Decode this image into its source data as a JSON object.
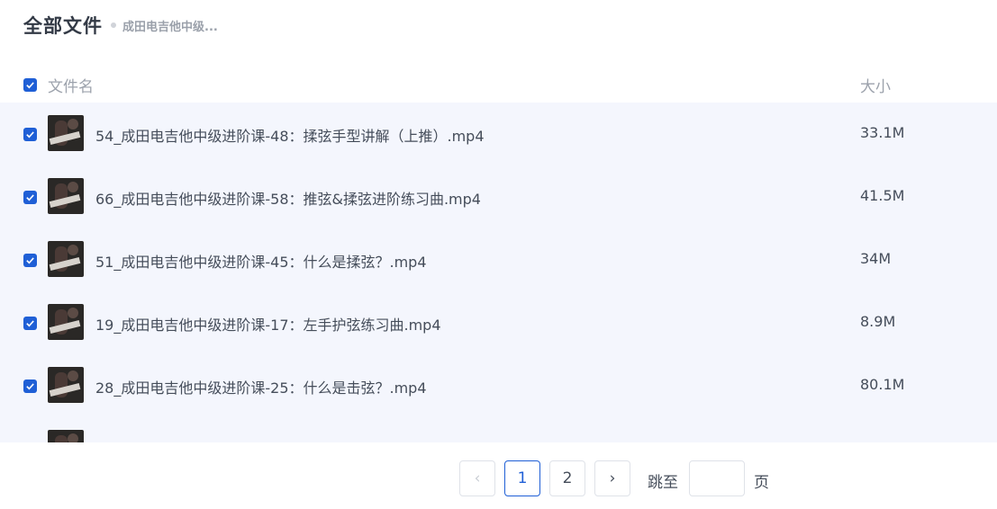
{
  "header": {
    "title": "全部文件",
    "breadcrumb": "成田电吉他中级..."
  },
  "columns": {
    "name": "文件名",
    "size": "大小"
  },
  "files": [
    {
      "name": "54_成田电吉他中级进阶课-48：揉弦手型讲解（上推）.mp4",
      "size": "33.1M",
      "checked": true
    },
    {
      "name": "66_成田电吉他中级进阶课-58：推弦&揉弦进阶练习曲.mp4",
      "size": "41.5M",
      "checked": true
    },
    {
      "name": "51_成田电吉他中级进阶课-45：什么是揉弦？.mp4",
      "size": "34M",
      "checked": true
    },
    {
      "name": "19_成田电吉他中级进阶课-17：左手护弦练习曲.mp4",
      "size": "8.9M",
      "checked": true
    },
    {
      "name": "28_成田电吉他中级进阶课-25：什么是击弦？.mp4",
      "size": "80.1M",
      "checked": true
    }
  ],
  "pagination": {
    "prev_icon": "‹",
    "pages": [
      "1",
      "2"
    ],
    "current_page": "1",
    "next_icon": "›",
    "jump_label": "跳至",
    "jump_value": "",
    "page_unit": "页"
  },
  "colors": {
    "accent": "#1f5fd6",
    "list_background": "#f4f6fd"
  }
}
